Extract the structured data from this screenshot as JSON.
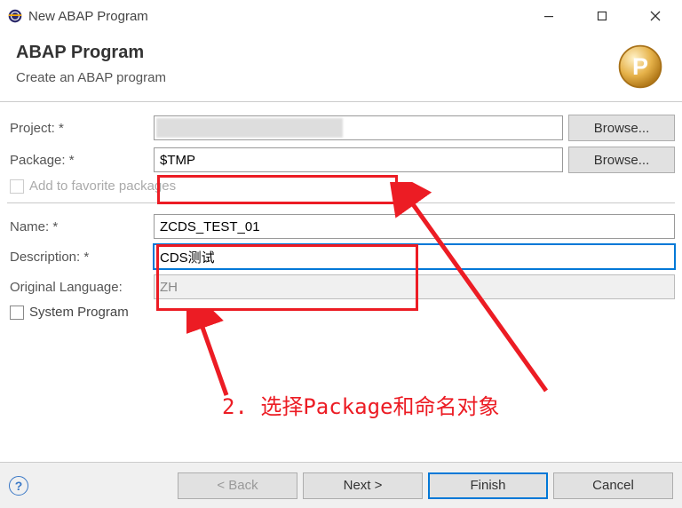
{
  "window": {
    "title": "New ABAP Program"
  },
  "header": {
    "heading": "ABAP Program",
    "subtitle": "Create an ABAP program"
  },
  "form": {
    "project_label": "Project: *",
    "project_value": "",
    "browse_label": "Browse...",
    "package_label": "Package: *",
    "package_value": "$TMP",
    "favorites_label": "Add to favorite packages",
    "name_label": "Name: *",
    "name_value": "ZCDS_TEST_01",
    "description_label": "Description: *",
    "description_value": "CDS测试",
    "language_label": "Original Language:",
    "language_value": "ZH",
    "system_prog_label": "System Program"
  },
  "annotation": {
    "text": "2. 选择Package和命名对象"
  },
  "footer": {
    "back": "< Back",
    "next": "Next >",
    "finish": "Finish",
    "cancel": "Cancel",
    "help_glyph": "?"
  }
}
